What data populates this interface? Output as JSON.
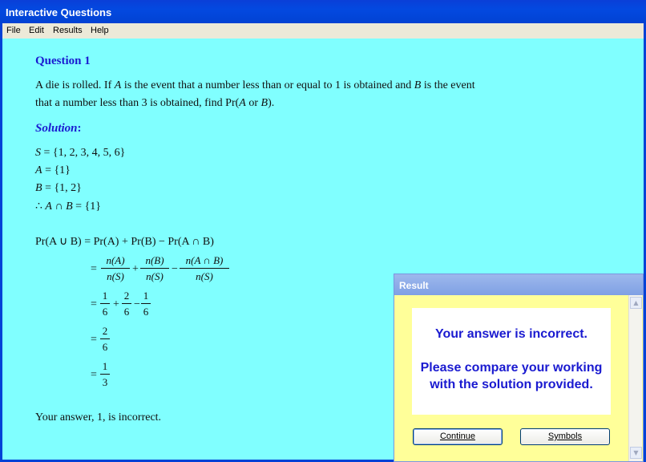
{
  "window": {
    "title": "Interactive Questions"
  },
  "menu": [
    "File",
    "Edit",
    "Results",
    "Help"
  ],
  "question": {
    "heading": "Question 1",
    "line1_a": "A die is rolled.  If ",
    "line1_b": "A",
    "line1_c": " is the event that a number less than or equal to 1 is obtained and ",
    "line1_d": "B",
    "line1_e": " is the event",
    "line2_a": "that a number less than 3 is obtained, find Pr(",
    "line2_b": "A",
    "line2_c": " or ",
    "line2_d": "B",
    "line2_e": ")."
  },
  "solution": {
    "label": "Solution",
    "colon": ":",
    "sets": [
      {
        "var": "S",
        "rest": " = {1, 2, 3, 4, 5, 6}"
      },
      {
        "var": "A",
        "rest": " = {1}"
      },
      {
        "var": "B",
        "rest": " = {1, 2}"
      }
    ],
    "intersection": {
      "therefore": "∴ ",
      "a": "A",
      "cap": " ∩ ",
      "b": "B",
      "rest": " = {1}"
    },
    "formula": {
      "lhs": "Pr(A ∪ B) = Pr(A) + Pr(B) − Pr(A ∩ B)"
    },
    "step1": {
      "f1n": "n(A)",
      "f1d": "n(S)",
      "f2n": "n(B)",
      "f2d": "n(S)",
      "f3n": "n(A ∩ B)",
      "f3d": "n(S)"
    },
    "step2": {
      "f1n": "1",
      "f1d": "6",
      "f2n": "2",
      "f2d": "6",
      "f3n": "1",
      "f3d": "6"
    },
    "step3": {
      "n": "2",
      "d": "6"
    },
    "step4": {
      "n": "1",
      "d": "3"
    },
    "eq": "=",
    "plus": "+",
    "minus": "−"
  },
  "feedback": "Your answer, 1, is incorrect.",
  "dialog": {
    "title": "Result",
    "line1": "Your answer is incorrect.",
    "line2": "Please compare your working",
    "line3": "with the solution provided.",
    "continue_label": "Continue",
    "symbols_label": "Symbols"
  }
}
